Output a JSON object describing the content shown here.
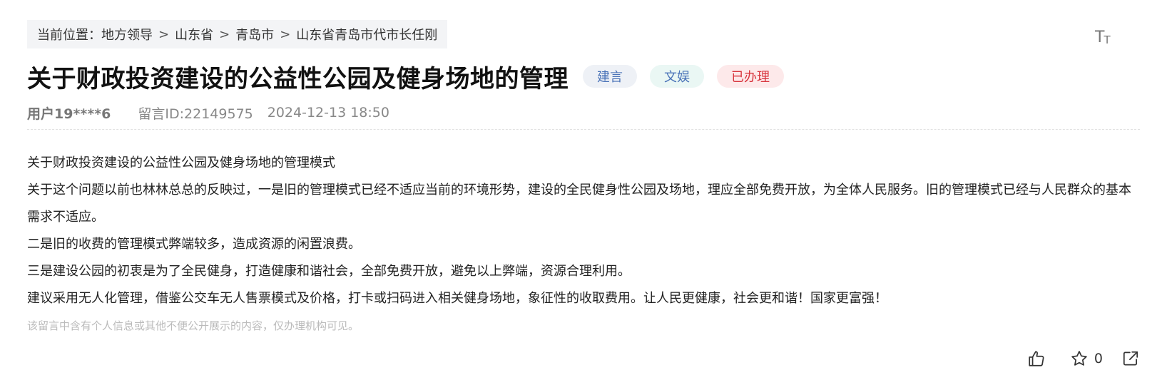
{
  "breadcrumb": {
    "prefix": "当前位置：",
    "items": [
      "地方领导",
      "山东省",
      "青岛市",
      "山东省青岛市代市长任刚"
    ],
    "separator": ">"
  },
  "toolbar": {
    "font_size_icon": "text-size-icon",
    "font_size_big": "T",
    "font_size_small": "T"
  },
  "message": {
    "title": "关于财政投资建设的公益性公园及健身场地的管理",
    "tags": {
      "type": "建言",
      "category": "文娱",
      "status": "已办理"
    },
    "user": "用户19****6",
    "id_text": "留言ID:22149575",
    "datetime": "2024-12-13 18:50",
    "paragraphs": [
      "关于财政投资建设的公益性公园及健身场地的管理模式",
      "关于这个问题以前也林林总总的反映过，一是旧的管理模式已经不适应当前的环境形势，建设的全民健身性公园及场地，理应全部免费开放，为全体人民服务。旧的管理模式已经与人民群众的基本需求不适应。",
      "二是旧的收费的管理模式弊端较多，造成资源的闲置浪费。",
      "三是建设公园的初衷是为了全民健身，打造健康和谐社会，全部免费开放，避免以上弊端，资源合理利用。",
      "建议采用无人化管理，借鉴公交车无人售票模式及价格，打卡或扫码进入相关健身场地，象征性的收取费用。让人民更健康，社会更和谐！国家更富强！"
    ],
    "privacy_note": "该留言中含有个人信息或其他不便公开展示的内容，仅办理机构可见。"
  },
  "actions": {
    "like_icon": "thumbs-up-icon",
    "favorite_icon": "star-icon",
    "favorite_count": "0",
    "share_icon": "share-icon"
  },
  "colors": {
    "tag_type_bg": "#eef1f6",
    "tag_type_text": "#4a73b8",
    "tag_category_bg": "#eaf7f4",
    "tag_status_bg": "#fde9ea",
    "tag_status_text": "#d8363f",
    "breadcrumb_bg": "#f3f4f6"
  }
}
